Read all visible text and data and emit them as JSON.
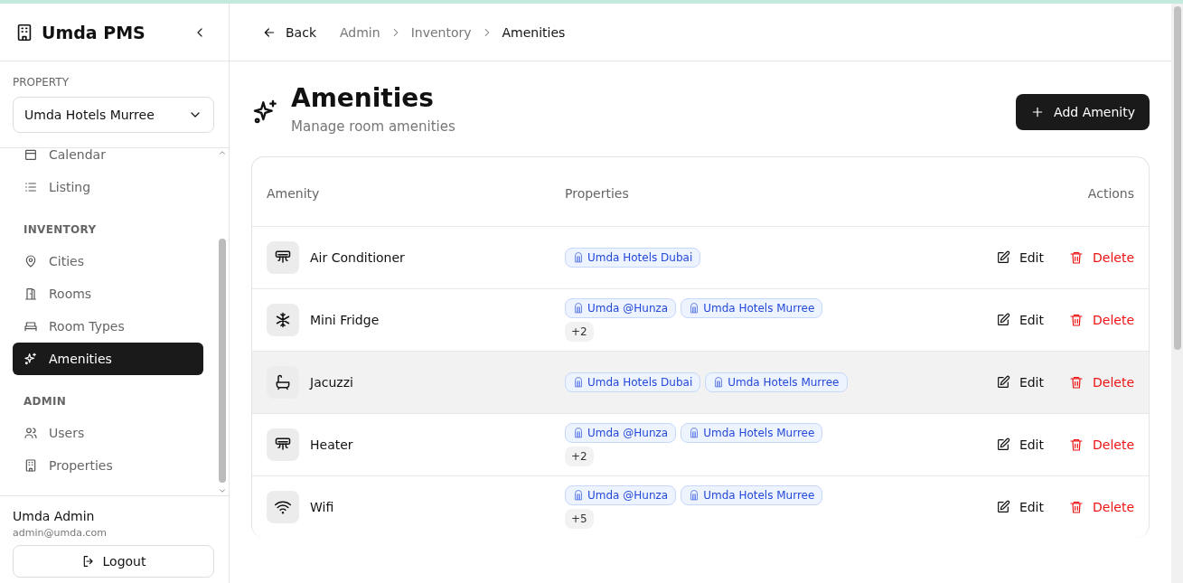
{
  "sidebar": {
    "brand": "Umda PMS",
    "property_label": "PROPERTY",
    "property_select": "Umda Hotels Murree",
    "sections": [
      {
        "items": [
          {
            "label": "Calendar",
            "kind": "calendar",
            "selected": false
          },
          {
            "label": "Listing",
            "kind": "list",
            "selected": false
          }
        ]
      },
      {
        "heading": "INVENTORY",
        "items": [
          {
            "label": "Cities",
            "kind": "pin",
            "selected": false
          },
          {
            "label": "Rooms",
            "kind": "door",
            "selected": false
          },
          {
            "label": "Room Types",
            "kind": "bed",
            "selected": false
          },
          {
            "label": "Amenities",
            "kind": "sparkles",
            "selected": true
          }
        ]
      },
      {
        "heading": "ADMIN",
        "items": [
          {
            "label": "Users",
            "kind": "users",
            "selected": false
          },
          {
            "label": "Properties",
            "kind": "building",
            "selected": false
          }
        ]
      }
    ],
    "user": {
      "name": "Umda Admin",
      "email": "admin@umda.com"
    },
    "logout": "Logout"
  },
  "topbar": {
    "back": "Back",
    "breadcrumbs": [
      "Admin",
      "Inventory",
      "Amenities"
    ]
  },
  "page": {
    "title": "Amenities",
    "subtitle": "Manage room amenities",
    "add_button": "Add Amenity"
  },
  "table": {
    "columns": [
      "Amenity",
      "Properties",
      "Actions"
    ],
    "rows": [
      {
        "name": "Air Conditioner",
        "kind": "ac",
        "highlighted": false,
        "properties": [
          "Umda Hotels Dubai"
        ],
        "more": null,
        "edit": "Edit",
        "delete": "Delete"
      },
      {
        "name": "Mini Fridge",
        "kind": "snowflake",
        "highlighted": false,
        "properties": [
          "Umda @Hunza",
          "Umda Hotels Murree"
        ],
        "more": "+2",
        "edit": "Edit",
        "delete": "Delete"
      },
      {
        "name": "Jacuzzi",
        "kind": "bath",
        "highlighted": true,
        "properties": [
          "Umda Hotels Dubai",
          "Umda Hotels Murree"
        ],
        "more": null,
        "edit": "Edit",
        "delete": "Delete"
      },
      {
        "name": "Heater",
        "kind": "ac",
        "highlighted": false,
        "properties": [
          "Umda @Hunza",
          "Umda Hotels Murree"
        ],
        "more": "+2",
        "edit": "Edit",
        "delete": "Delete"
      },
      {
        "name": "Wifi",
        "kind": "wifi",
        "highlighted": false,
        "properties": [
          "Umda @Hunza",
          "Umda Hotels Murree"
        ],
        "more": "+5",
        "edit": "Edit",
        "delete": "Delete"
      }
    ]
  }
}
